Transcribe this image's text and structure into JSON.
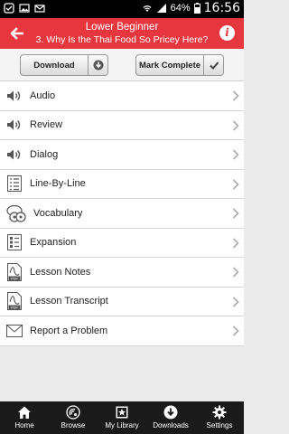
{
  "status": {
    "battery": "64%",
    "time": "16:56"
  },
  "header": {
    "level": "Lower Beginner",
    "lesson_title": "3. Why Is the Thai Food So Pricey Here?"
  },
  "actions": {
    "download_label": "Download",
    "mark_complete_label": "Mark Complete"
  },
  "menu": [
    {
      "label": "Audio",
      "icon": "speaker-icon"
    },
    {
      "label": "Review",
      "icon": "speaker-icon"
    },
    {
      "label": "Dialog",
      "icon": "speaker-icon"
    },
    {
      "label": "Line-By-Line",
      "icon": "list-icon"
    },
    {
      "label": "Vocabulary",
      "icon": "vocabulary-icon"
    },
    {
      "label": "Expansion",
      "icon": "checklist-icon"
    },
    {
      "label": "Lesson Notes",
      "icon": "pdf-icon"
    },
    {
      "label": "Lesson Transcript",
      "icon": "pdf-icon"
    },
    {
      "label": "Report a Problem",
      "icon": "envelope-icon"
    }
  ],
  "bottom_nav": [
    {
      "label": "Home",
      "icon": "home-icon"
    },
    {
      "label": "Browse",
      "icon": "browse-icon"
    },
    {
      "label": "My Library",
      "icon": "library-icon"
    },
    {
      "label": "Downloads",
      "icon": "download-icon"
    },
    {
      "label": "Settings",
      "icon": "gear-icon"
    }
  ],
  "colors": {
    "header": "#e8363f",
    "nav_background": "#1a1a1a",
    "page_background": "#ebebeb"
  }
}
